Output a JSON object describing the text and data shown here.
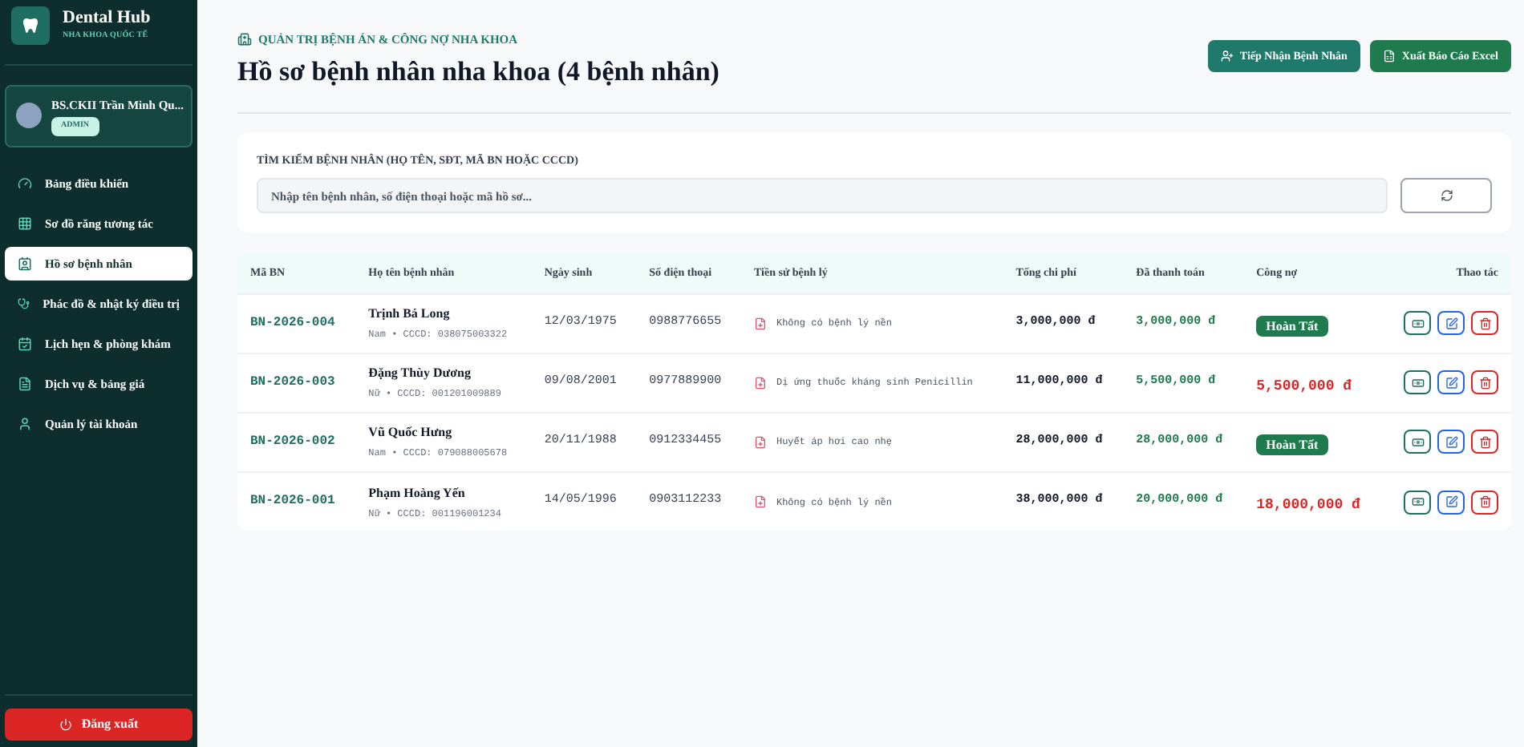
{
  "brand": {
    "name": "Dental Hub",
    "tagline": "NHA KHOA QUỐC TẾ"
  },
  "user": {
    "name": "BS.CKII Trần Minh Qu...",
    "role": "ADMIN"
  },
  "nav": [
    {
      "label": "Bảng điều khiển",
      "selected": false
    },
    {
      "label": "Sơ đồ răng tương tác",
      "selected": false
    },
    {
      "label": "Hồ sơ bệnh nhân",
      "selected": true
    },
    {
      "label": "Phác đồ & nhật ký điều trị",
      "selected": false
    },
    {
      "label": "Lịch hẹn & phòng khám",
      "selected": false
    },
    {
      "label": "Dịch vụ & bảng giá",
      "selected": false
    },
    {
      "label": "Quản lý tài khoản",
      "selected": false
    }
  ],
  "logout": "Đăng xuất",
  "header": {
    "eyebrow": "QUẢN TRỊ BỆNH ÁN & CÔNG NỢ NHA KHOA",
    "title": "Hồ sơ bệnh nhân nha khoa (4 bệnh nhân)",
    "buttons": [
      "Tiếp Nhận Bệnh Nhân",
      "Xuất Báo Cáo Excel"
    ]
  },
  "search": {
    "label": "TÌM KIẾM BỆNH NHÂN (HỌ TÊN, SĐT, MÃ BN HOẶC CCCD)",
    "placeholder": "Nhập tên bệnh nhân, số điện thoại hoặc mã hồ sơ..."
  },
  "table": {
    "columns": [
      "Mã BN",
      "Họ tên bệnh nhân",
      "Ngày sinh",
      "Số điện thoại",
      "Tiền sử bệnh lý",
      "Tổng chi phí",
      "Đã thanh toán",
      "Công nợ",
      "Thao tác"
    ],
    "rows": [
      {
        "id": "BN-2026-004",
        "name": "Trịnh Bá Long",
        "sub": "Nam • CCCD: 038075003322",
        "dob": "12/03/1975",
        "phone": "0988776655",
        "history": "Không có bệnh lý nền",
        "total": "3,000,000 đ",
        "paid": "3,000,000 đ",
        "debt": {
          "kind": "badge",
          "text": "Hoàn Tất"
        }
      },
      {
        "id": "BN-2026-003",
        "name": "Đặng Thùy Dương",
        "sub": "Nữ • CCCD: 001201009889",
        "dob": "09/08/2001",
        "phone": "0977889900",
        "history": "Dị ứng thuốc kháng sinh Penicillin",
        "total": "11,000,000 đ",
        "paid": "5,500,000 đ",
        "debt": {
          "kind": "amount",
          "text": "5,500,000 đ"
        }
      },
      {
        "id": "BN-2026-002",
        "name": "Vũ Quốc Hưng",
        "sub": "Nam • CCCD: 079088005678",
        "dob": "20/11/1988",
        "phone": "0912334455",
        "history": "Huyết áp hơi cao nhẹ",
        "total": "28,000,000 đ",
        "paid": "28,000,000 đ",
        "debt": {
          "kind": "badge",
          "text": "Hoàn Tất"
        }
      },
      {
        "id": "BN-2026-001",
        "name": "Phạm Hoàng Yến",
        "sub": "Nữ • CCCD: 001196001234",
        "dob": "14/05/1996",
        "phone": "0903112233",
        "history": "Không có bệnh lý nền",
        "total": "38,000,000 đ",
        "paid": "20,000,000 đ",
        "debt": {
          "kind": "amount",
          "text": "18,000,000 đ"
        }
      }
    ]
  }
}
